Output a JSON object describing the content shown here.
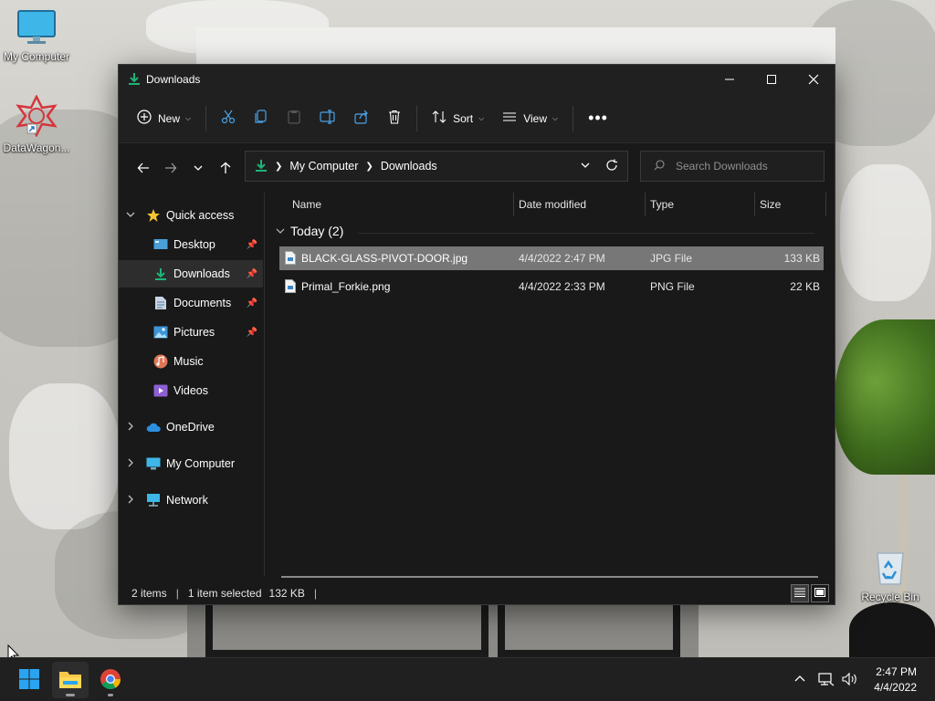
{
  "desktop": {
    "icons": [
      {
        "label": "My Computer"
      },
      {
        "label": "DataWagon..."
      },
      {
        "label": "Recycle Bin"
      }
    ]
  },
  "window": {
    "title": "Downloads",
    "toolbar": {
      "new_label": "New",
      "sort_label": "Sort",
      "view_label": "View"
    },
    "breadcrumb": [
      "My Computer",
      "Downloads"
    ],
    "search_placeholder": "Search Downloads",
    "sidebar": {
      "quick_access": "Quick access",
      "pinned": [
        {
          "label": "Desktop",
          "pinned": true
        },
        {
          "label": "Downloads",
          "pinned": true,
          "selected": true
        },
        {
          "label": "Documents",
          "pinned": true
        },
        {
          "label": "Pictures",
          "pinned": true
        },
        {
          "label": "Music",
          "pinned": false
        },
        {
          "label": "Videos",
          "pinned": false
        }
      ],
      "roots": [
        "OneDrive",
        "My Computer",
        "Network"
      ]
    },
    "columns": {
      "name": "Name",
      "date": "Date modified",
      "type": "Type",
      "size": "Size"
    },
    "group_label": "Today (2)",
    "files": [
      {
        "name": "BLACK-GLASS-PIVOT-DOOR.jpg",
        "date": "4/4/2022 2:47 PM",
        "type": "JPG File",
        "size": "133 KB",
        "selected": true
      },
      {
        "name": "Primal_Forkie.png",
        "date": "4/4/2022 2:33 PM",
        "type": "PNG File",
        "size": "22 KB",
        "selected": false
      }
    ],
    "status": {
      "items": "2 items",
      "selected": "1 item selected",
      "size": "132 KB"
    }
  },
  "taskbar": {
    "time": "2:47 PM",
    "date": "4/4/2022"
  },
  "colors": {
    "accent": "#1fb376",
    "selection": "#777777",
    "window_bg": "#191919"
  }
}
